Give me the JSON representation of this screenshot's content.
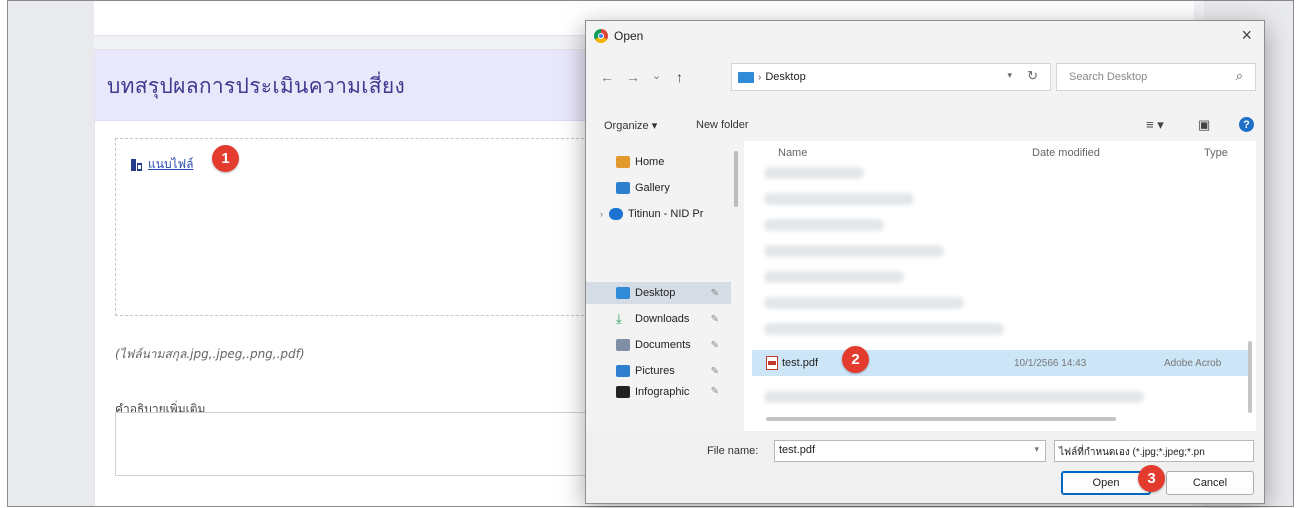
{
  "page": {
    "section_title": "บทสรุปผลการประเมินความเสี่ยง",
    "attach_label": "แนบไฟล์",
    "file_hint": "(ไฟล์นามสกุล.jpg,.jpeg,.png,.pdf)",
    "description_label": "คำอธิบายเพิ่มเติม"
  },
  "steps": [
    "1",
    "2",
    "3"
  ],
  "dialog": {
    "title": "Open",
    "close": "×",
    "nav": {
      "back": "←",
      "forward": "→",
      "down": "⌄",
      "up": "↑"
    },
    "address": {
      "path": "Desktop",
      "separator": "›"
    },
    "search_placeholder": "Search Desktop",
    "commands": {
      "organize": "Organize ▾",
      "new_folder": "New folder"
    },
    "columns": {
      "name": "Name",
      "date": "Date modified",
      "type": "Type"
    },
    "sidebar": [
      {
        "label": "Home",
        "color": "#e39a2d"
      },
      {
        "label": "Gallery",
        "color": "#2f7fd0"
      },
      {
        "label": "Titinun - NID Pr",
        "color": "#1a73d1"
      },
      {
        "label": "Desktop",
        "color": "#2f8ad8",
        "selected": true,
        "pinned": true
      },
      {
        "label": "Downloads",
        "color": "#1f9d55",
        "pinned": true
      },
      {
        "label": "Documents",
        "color": "#7f8fa6",
        "pinned": true
      },
      {
        "label": "Pictures",
        "color": "#2f7fd0",
        "pinned": true
      },
      {
        "label": "Infographic",
        "color": "#222222",
        "pinned": true
      }
    ],
    "selected_file": {
      "name": "test.pdf",
      "date": "10/1/2566 14:43",
      "type": "Adobe Acrob"
    },
    "file_name_label": "File name:",
    "file_name_value": "test.pdf",
    "filter": "ไฟล์ที่กำหนดเอง (*.jpg;*.jpeg;*.pn",
    "open_button": "Open",
    "cancel_button": "Cancel"
  }
}
